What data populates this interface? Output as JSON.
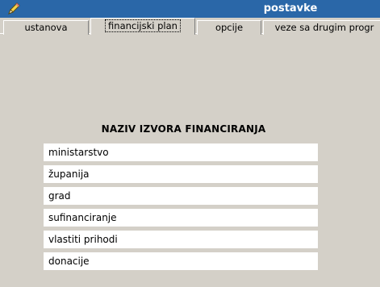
{
  "window": {
    "title": "postavke",
    "icon": "pencil-icon"
  },
  "tabs": [
    {
      "label": "ustanova",
      "active": false
    },
    {
      "label": "financijski plan",
      "active": true
    },
    {
      "label": "opcije",
      "active": false
    },
    {
      "label": "veze sa drugim progr",
      "active": false
    }
  ],
  "funding": {
    "heading": "NAZIV IZVORA FINANCIRANJA",
    "sources": [
      "ministarstvo",
      "županija",
      "grad",
      "sufinanciranje",
      "vlastiti prihodi",
      "donacije"
    ]
  }
}
